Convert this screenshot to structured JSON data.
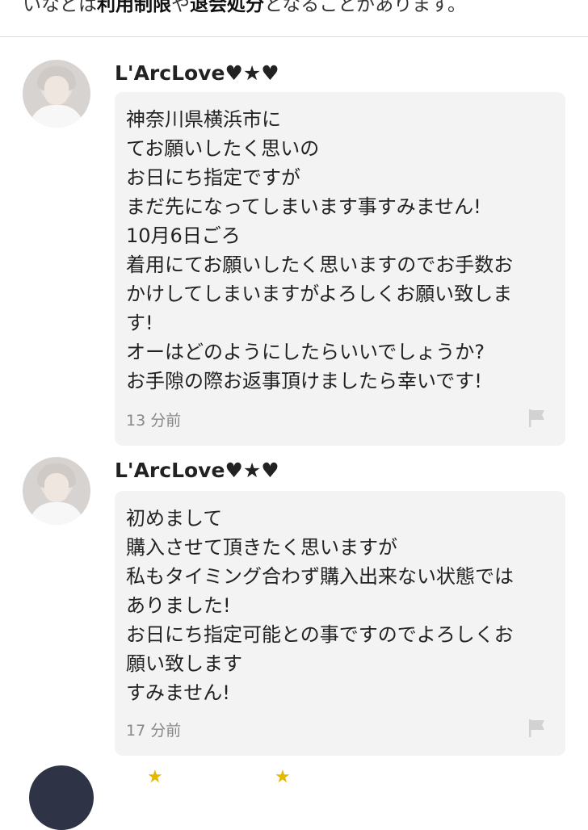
{
  "notice": {
    "prefix": "いなどは",
    "term1": "利用制限",
    "mid": "や",
    "term2": "退会処分",
    "suffix": "となることがあります。"
  },
  "comments": [
    {
      "username": "L'ArcLove♥★♥",
      "lines": [
        "神奈川県横浜市に",
        "てお願いしたく思いの",
        "お日にち指定ですが",
        "まだ先になってしまいます事すみません!",
        "10月6日ごろ",
        "着用にてお願いしたく思いますのでお手数お",
        "かけしてしまいますがよろしくお願い致しま",
        "す!",
        "オーはどのようにしたらいいでしょうか?",
        "お手隙の際お返事頂けましたら幸いです!"
      ],
      "time": "13 分前"
    },
    {
      "username": "L'ArcLove♥★♥",
      "lines": [
        "初めまして",
        "購入させて頂きたく思いますが",
        "私もタイミング合わず購入出来ない状態では",
        "ありました!",
        "お日にち指定可能との事ですのでよろしくお",
        "願い致します",
        "すみません!"
      ],
      "time": "17 分前"
    }
  ],
  "icons": {
    "flag": "flag-icon",
    "avatar": "avatar"
  },
  "colors": {
    "bubble": "#f3f3f3",
    "timestamp": "#888888",
    "flag": "#d2d2d2"
  }
}
